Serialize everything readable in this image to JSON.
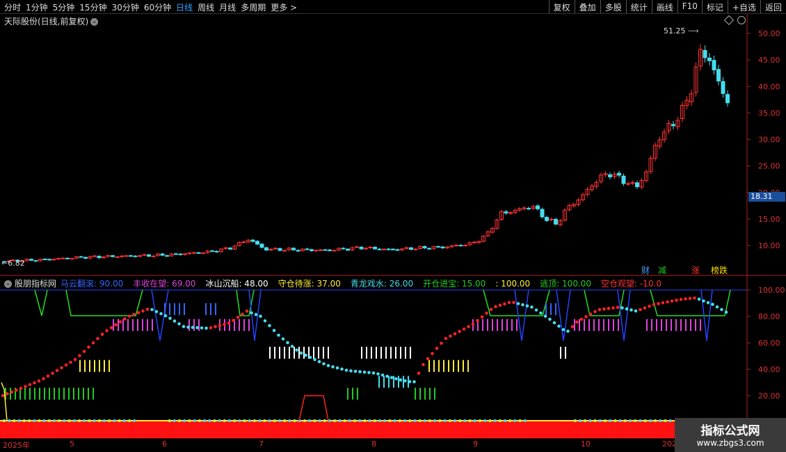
{
  "toolbar": {
    "periods": [
      "分时",
      "1分钟",
      "5分钟",
      "15分钟",
      "30分钟",
      "60分钟",
      "日线",
      "周线",
      "月线",
      "多周期",
      "更多 >"
    ],
    "active_period": "日线",
    "actions": [
      "复权",
      "叠加",
      "多股",
      "统计",
      "画线",
      "F10",
      "标记",
      "+自选",
      "返回"
    ]
  },
  "main_chart": {
    "title": "天际股份(日线,前复权)",
    "high_label": "51.25",
    "low_label": "6.82",
    "current_price": "18.31",
    "y_ticks": [
      "50.00",
      "45.00",
      "40.00",
      "35.00",
      "30.00",
      "25.00",
      "20.00",
      "15.00",
      "10.00"
    ],
    "y_values": [
      50,
      45,
      40,
      35,
      30,
      25,
      20,
      15,
      10
    ],
    "tags": [
      {
        "text": "财",
        "color": "#3aa0ff"
      },
      {
        "text": "减",
        "color": "#22cc22"
      },
      {
        "text": "涨",
        "color": "#ff3333"
      },
      {
        "text": "榜跌",
        "color": "#ffdd00"
      }
    ],
    "colors": {
      "up": "#ff3333",
      "down": "#44ddee"
    }
  },
  "indicator": {
    "name": "股朋指标网",
    "items": [
      {
        "label": "马云翻滚:",
        "value": "90.00",
        "color": "#3366ff"
      },
      {
        "label": "丰收在望:",
        "value": "69.00",
        "color": "#dd44dd"
      },
      {
        "label": "冰山沉船:",
        "value": "48.00",
        "color": "#ffffff"
      },
      {
        "label": "守仓待涨:",
        "value": "37.00",
        "color": "#ffee33"
      },
      {
        "label": "青龙戏水:",
        "value": "26.00",
        "color": "#44ddee"
      },
      {
        "label": "开仓进宝:",
        "value": "15.00",
        "color": "#22cc22"
      },
      {
        "label": ":",
        "value": "100.00",
        "color": "#ffee33"
      },
      {
        "label": "逃顶:",
        "value": "100.00",
        "color": "#22cc22"
      },
      {
        "label": "空仓观望:",
        "value": "-10.0",
        "color": "#ff3333"
      }
    ],
    "y_ticks": [
      "100.00",
      "80.00",
      "60.00",
      "40.00",
      "20.00"
    ],
    "y_values": [
      100,
      80,
      60,
      40,
      20
    ]
  },
  "date_axis": [
    "2025年",
    "5",
    "6",
    "7",
    "8",
    "9",
    "10",
    "202"
  ],
  "watermark": {
    "line1": "指标公式网",
    "line2": "www.zbgs3.com"
  }
}
